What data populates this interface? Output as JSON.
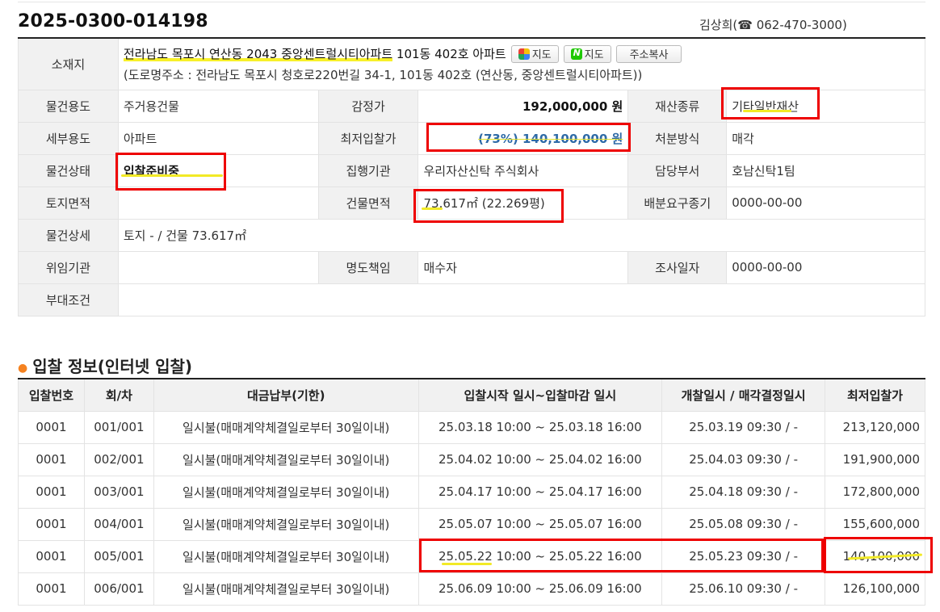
{
  "header": {
    "case_number": "2025-0300-014198",
    "contact": "김상희(☎ 062-470-3000)"
  },
  "info": {
    "location_label": "소재지",
    "address_main": "전라남도 목포시 연산동 2043 중앙센트럴시티아파트",
    "address_sub": "101동 402호 아파트",
    "map_daum_label": "지도",
    "map_naver_label": "지도",
    "copy_address_label": "주소복사",
    "road_address": "(도로명주소 : 전라남도 목포시 청호로220번길 34-1, 101동 402호 (연산동, 중앙센트럴시티아파트))",
    "rows": [
      {
        "k1": "물건용도",
        "v1": "주거용건물",
        "k2": "감정가",
        "v2": "192,000,000 원",
        "k3": "재산종류",
        "v3": "기타일반재산"
      },
      {
        "k1": "세부용도",
        "v1": "아파트",
        "k2": "최저입찰가",
        "v2": "(73%) 140,100,000 원",
        "k3": "처분방식",
        "v3": "매각"
      },
      {
        "k1": "물건상태",
        "v1": "입찰준비중",
        "k2": "집행기관",
        "v2": "우리자산신탁 주식회사",
        "k3": "담당부서",
        "v3": "호남신탁1팀"
      },
      {
        "k1": "토지면적",
        "v1": "",
        "k2": "건물면적",
        "v2": "73.617㎡ (22.269평)",
        "k3": "배분요구종기",
        "v3": "0000-00-00"
      },
      {
        "k1": "물건상세",
        "v1": "토지 - / 건물 73.617㎡"
      },
      {
        "k1": "위임기관",
        "v1": "",
        "k2": "명도책임",
        "v2": "매수자",
        "k3": "조사일자",
        "v3": "0000-00-00"
      },
      {
        "k1": "부대조건",
        "v1": ""
      }
    ]
  },
  "bid_section": {
    "title": "입찰 정보(인터넷 입찰)",
    "columns": [
      "입찰번호",
      "회/차",
      "대금납부(기한)",
      "입찰시작 일시~입찰마감 일시",
      "개찰일시 / 매각결정일시",
      "최저입찰가"
    ],
    "rows": [
      [
        "0001",
        "001/001",
        "일시불(매매계약체결일로부터 30일이내)",
        "25.03.18 10:00 ~ 25.03.18 16:00",
        "25.03.19 09:30 / -",
        "213,120,000"
      ],
      [
        "0001",
        "002/001",
        "일시불(매매계약체결일로부터 30일이내)",
        "25.04.02 10:00 ~ 25.04.02 16:00",
        "25.04.03 09:30 / -",
        "191,900,000"
      ],
      [
        "0001",
        "003/001",
        "일시불(매매계약체결일로부터 30일이내)",
        "25.04.17 10:00 ~ 25.04.17 16:00",
        "25.04.18 09:30 / -",
        "172,800,000"
      ],
      [
        "0001",
        "004/001",
        "일시불(매매계약체결일로부터 30일이내)",
        "25.05.07 10:00 ~ 25.05.07 16:00",
        "25.05.08 09:30 / -",
        "155,600,000"
      ],
      [
        "0001",
        "005/001",
        "일시불(매매계약체결일로부터 30일이내)",
        "25.05.22 10:00 ~ 25.05.22 16:00",
        "25.05.23 09:30 / -",
        "140,100,000"
      ],
      [
        "0001",
        "006/001",
        "일시불(매매계약체결일로부터 30일이내)",
        "25.06.09 10:00 ~ 25.06.09 16:00",
        "25.06.10 09:30 / -",
        "126,100,000"
      ]
    ]
  },
  "colors": {
    "highlight_box": "#e00000",
    "highlighter": "#f2ea26",
    "min_price_text": "#2e6aa6",
    "section_bullet": "#f58220"
  }
}
